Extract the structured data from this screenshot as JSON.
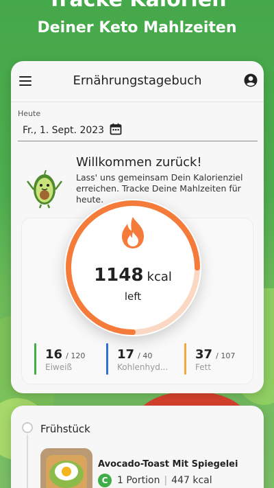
{
  "hero": {
    "title": "Tracke Kalorien",
    "subtitle": "Deiner Keto Mahlzeiten"
  },
  "appbar": {
    "title": "Ernährungstagebuch",
    "menu_icon": "menu-icon",
    "profile_icon": "account-circle-icon"
  },
  "date": {
    "label": "Heute",
    "value": "Fr., 1. Sept. 2023",
    "icon": "calendar-icon"
  },
  "welcome": {
    "title": "Willkommen zurück!",
    "text": "Lass' uns gemeinsam Dein Kalorienziel erreichen. Tracke Deine Mahlzeiten für heute."
  },
  "calories": {
    "value": "1148",
    "unit": "kcal",
    "caption": "left",
    "progress_fraction": 0.75,
    "ring_color": "#f47b3a",
    "track_color": "#fbd8c3"
  },
  "macros": [
    {
      "value": "16",
      "of": "/ 120",
      "name": "Eiweiß",
      "color": "#3fae49"
    },
    {
      "value": "17",
      "of": "/ 40",
      "name": "Kohlenhyd...",
      "color": "#2f6fd6"
    },
    {
      "value": "37",
      "of": "/ 107",
      "name": "Fett",
      "color": "#f2a93b"
    }
  ],
  "meal": {
    "title": "Frühstück",
    "item": {
      "name": "Avocado-Toast Mit Spiegelei",
      "badge": "C",
      "portion": "1 Portion",
      "separator": "|",
      "kcal": "447 kcal"
    }
  }
}
